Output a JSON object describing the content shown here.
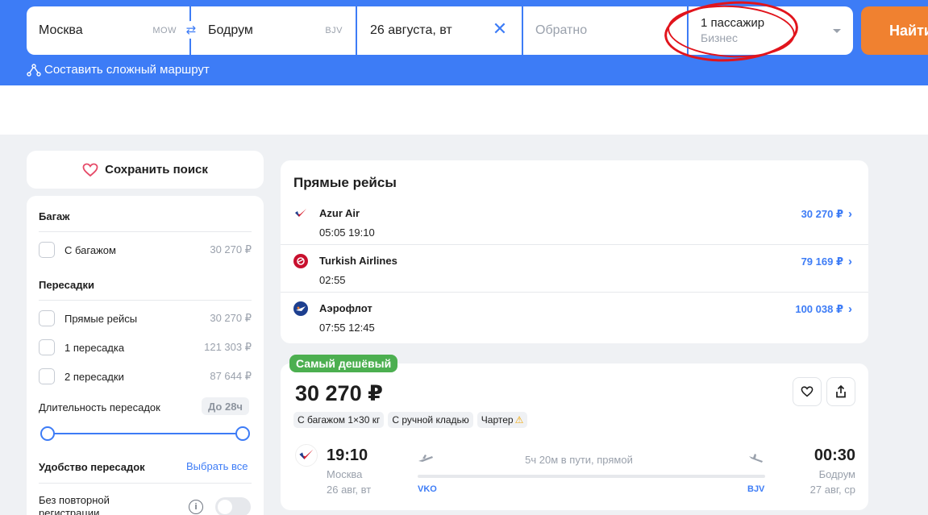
{
  "search": {
    "from_city": "Москва",
    "from_code": "MOW",
    "to_city": "Бодрум",
    "to_code": "BJV",
    "depart_date": "26 августа, вт",
    "return_placeholder": "Обратно",
    "passengers": "1 пассажир",
    "cabin_class": "Бизнес",
    "find_label": "Найти",
    "complex_route_label": "Составить сложный маршрут"
  },
  "sidebar": {
    "save_search_label": "Сохранить поиск",
    "baggage_heading": "Багаж",
    "baggage_option": {
      "label": "С багажом",
      "price": "30 270 ₽"
    },
    "transfers_heading": "Пересадки",
    "transfer_options": [
      {
        "label": "Прямые рейсы",
        "price": "30 270 ₽"
      },
      {
        "label": "1 пересадка",
        "price": "121 303 ₽"
      },
      {
        "label": "2 пересадки",
        "price": "87 644 ₽"
      }
    ],
    "duration_label": "Длительность пересадок",
    "duration_value": "До 28ч",
    "comfort_heading": "Удобство пересадок",
    "select_all": "Выбрать все",
    "no_rereg_label": "Без повторной регистрации"
  },
  "direct_flights": {
    "title": "Прямые рейсы",
    "flights": [
      {
        "airline": "Azur Air",
        "times": "05:05  19:10",
        "price": "30 270 ₽",
        "logo_color": "#d81b2a"
      },
      {
        "airline": "Turkish Airlines",
        "times": "02:55",
        "price": "79 169 ₽",
        "logo_color": "#c8102e"
      },
      {
        "airline": "Аэрофлот",
        "times": "07:55  12:45",
        "price": "100 038 ₽",
        "logo_color": "#1d3f8f"
      }
    ]
  },
  "ticket": {
    "badge": "Самый дешёвый",
    "price": "30 270 ₽",
    "chips": [
      "С багажом 1×30 кг",
      "С ручной кладью",
      "Чартер"
    ],
    "depart_time": "19:10",
    "depart_city": "Москва",
    "depart_date": "26 авг, вт",
    "duration": "5ч 20м в пути, прямой",
    "origin_code": "VKO",
    "dest_code": "BJV",
    "arrive_time": "00:30",
    "arrive_city": "Бодрум",
    "arrive_date": "27 авг, ср"
  },
  "icons": {
    "swap": "swap-arrows-icon",
    "clear": "close-icon",
    "route": "route-icon",
    "heart": "heart-icon",
    "share": "share-icon",
    "info": "info-icon"
  }
}
